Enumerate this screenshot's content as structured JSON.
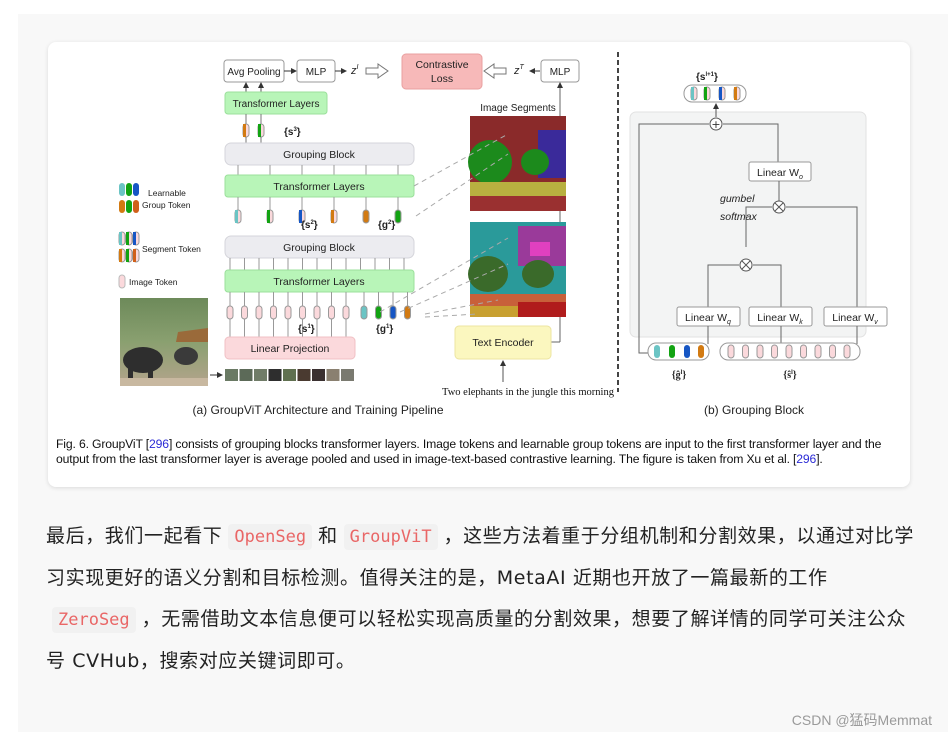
{
  "figure": {
    "panel_a": {
      "avg_pooling": "Avg Pooling",
      "mlp_left": "MLP",
      "z_image": "z",
      "z_image_sup": "I",
      "contrastive_loss_line1": "Contrastive",
      "contrastive_loss_line2": "Loss",
      "z_text": "z",
      "z_text_sup": "T",
      "mlp_right": "MLP",
      "transformer_layers": "Transformer Layers",
      "grouping_block": "Grouping Block",
      "linear_projection": "Linear Projection",
      "s3_label": "{s",
      "s3_sup": "3",
      "s2_label": "{s",
      "s2_sup": "2",
      "g2_label": "{g",
      "g2_sup": "2",
      "s1_label": "{s",
      "s1_sup": "1",
      "g1_label": "{g",
      "g1_sup": "1",
      "index_sub": "i",
      "close_brace": "}",
      "image_segments": "Image Segments",
      "text_encoder": "Text Encoder",
      "text_input": "Two elephants in the jungle this morning",
      "subcaption": "(a) GroupViT Architecture and Training Pipeline",
      "legend": {
        "learnable": "Learnable",
        "group_token": "Group Token",
        "segment_token": "Segment Token",
        "image_token": "Image Token"
      }
    },
    "panel_b": {
      "output_label": "{s",
      "output_sup": "l+1",
      "linear_wo": "Linear W",
      "wo_sub": "o",
      "gumbel": "gumbel",
      "softmax": "softmax",
      "linear_wq": "Linear W",
      "wq_sub": "q",
      "linear_wk": "Linear W",
      "wk_sub": "k",
      "linear_wv": "Linear W",
      "wv_sub": "v",
      "g_hat_label": "{ĝ",
      "s_hat_label": "{ŝ",
      "hat_sup": "l",
      "subcaption": "(b) Grouping Block"
    },
    "colors": {
      "transformer": "#b8f5b8",
      "grouping": "#ececf0",
      "contrastive": "#f7b9b9",
      "linear_projection": "#fbd9dc",
      "text_encoder": "#fbf7bf",
      "token_teal": "#6bc4c4",
      "token_green": "#12a312",
      "token_blue": "#1656c4",
      "token_orange": "#d27a12",
      "token_pink": "#fbd9dc"
    }
  },
  "caption": {
    "prefix": "Fig. 6. GroupViT [",
    "ref1": "296",
    "middle": "] consists of grouping blocks transformer layers. Image tokens and learnable group tokens are input to the first transformer layer and the output from the last transformer layer is average pooled and used in image-text-based contrastive learning. The figure is taken from Xu et al. [",
    "ref2": "296",
    "suffix": "]."
  },
  "paragraph": {
    "t1": "最后，我们一起看下",
    "code1": "OpenSeg",
    "t2": "和",
    "code2": "GroupViT",
    "t3": "，这些方法着重于分组机制和分割效果，以通过对比学习实现更好的语义分割和目标检测。值得关注的是，MetaAI 近期也开放了一篇最新的工作",
    "code3": "ZeroSeg",
    "t4": "，无需借助文本信息便可以轻松实现高质量的分割效果，想要了解详情的同学可关注公众号 CVHub，搜索对应关键词即可。"
  },
  "watermark": "CSDN @猛码Memmat"
}
